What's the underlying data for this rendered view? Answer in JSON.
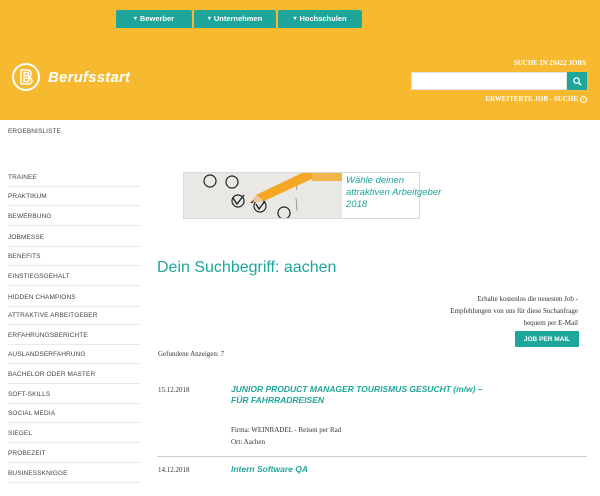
{
  "nav_tabs": [
    {
      "label": "Bewerber"
    },
    {
      "label": "Unternehmen"
    },
    {
      "label": "Hochschulen"
    }
  ],
  "logo": {
    "text": "Berufsstart"
  },
  "search": {
    "count_label": "SUCHE IN 29422 JOBS",
    "input_value": "",
    "advanced_label": "ERWEITERTE JOB - SUCHE"
  },
  "sidebar": {
    "items": [
      {
        "label": "ERGEBNISLISTE"
      },
      {
        "label": "TRAINEE"
      },
      {
        "label": "PRAKTIKUM"
      },
      {
        "label": "BEWERBUNG"
      },
      {
        "label": "JOBMESSE"
      },
      {
        "label": "BENEFITS"
      },
      {
        "label": "EINSTIEGSGEHALT"
      },
      {
        "label": "HIDDEN CHAMPIONS"
      },
      {
        "label": "ATTRAKTIVE ARBEITGEBER"
      },
      {
        "label": "ERFAHRUNGSBERICHTE"
      },
      {
        "label": "AUSLANDSERFAHRUNG"
      },
      {
        "label": "BACHELOR ODER MASTER"
      },
      {
        "label": "SOFT-SKILLS"
      },
      {
        "label": "SOCIAL MEDIA"
      },
      {
        "label": "SIEGEL"
      },
      {
        "label": "PROBEZEIT"
      },
      {
        "label": "BUSINESSKNIGGE"
      }
    ]
  },
  "banner": {
    "lines": [
      "Wähle deinen",
      "attraktiven Arbeitgeber",
      "2018"
    ]
  },
  "main": {
    "heading": "Dein Suchbegriff: aachen",
    "notify_lines": [
      "Erhalte kostenlos die neuesten Job -",
      "Empfehlungen von uns für diese Suchanfrage",
      "bequem per E-Mail"
    ],
    "notify_button": "JOB PER MAIL",
    "found_label": "Gefundene Anzeigen: 7"
  },
  "jobs": [
    {
      "date": "15.12.2018",
      "title_lines": [
        "JUNIOR PRODUCT MANAGER TOURISMUS GESUCHT (m/w) –",
        "FÜR FAHRRADREISEN"
      ],
      "company": "Firma: WEINRADEL - Reisen per Rad",
      "location": "Ort: Aachen"
    },
    {
      "date": "14.12.2018",
      "title_lines": [
        "Intern Software QA"
      ],
      "company": "",
      "location": ""
    }
  ],
  "colors": {
    "accent": "#1fa69a",
    "brand": "#f7b92f"
  },
  "icons": [
    "chevron-down-icon",
    "search-icon",
    "info-circle-icon",
    "logo-b-icon"
  ]
}
